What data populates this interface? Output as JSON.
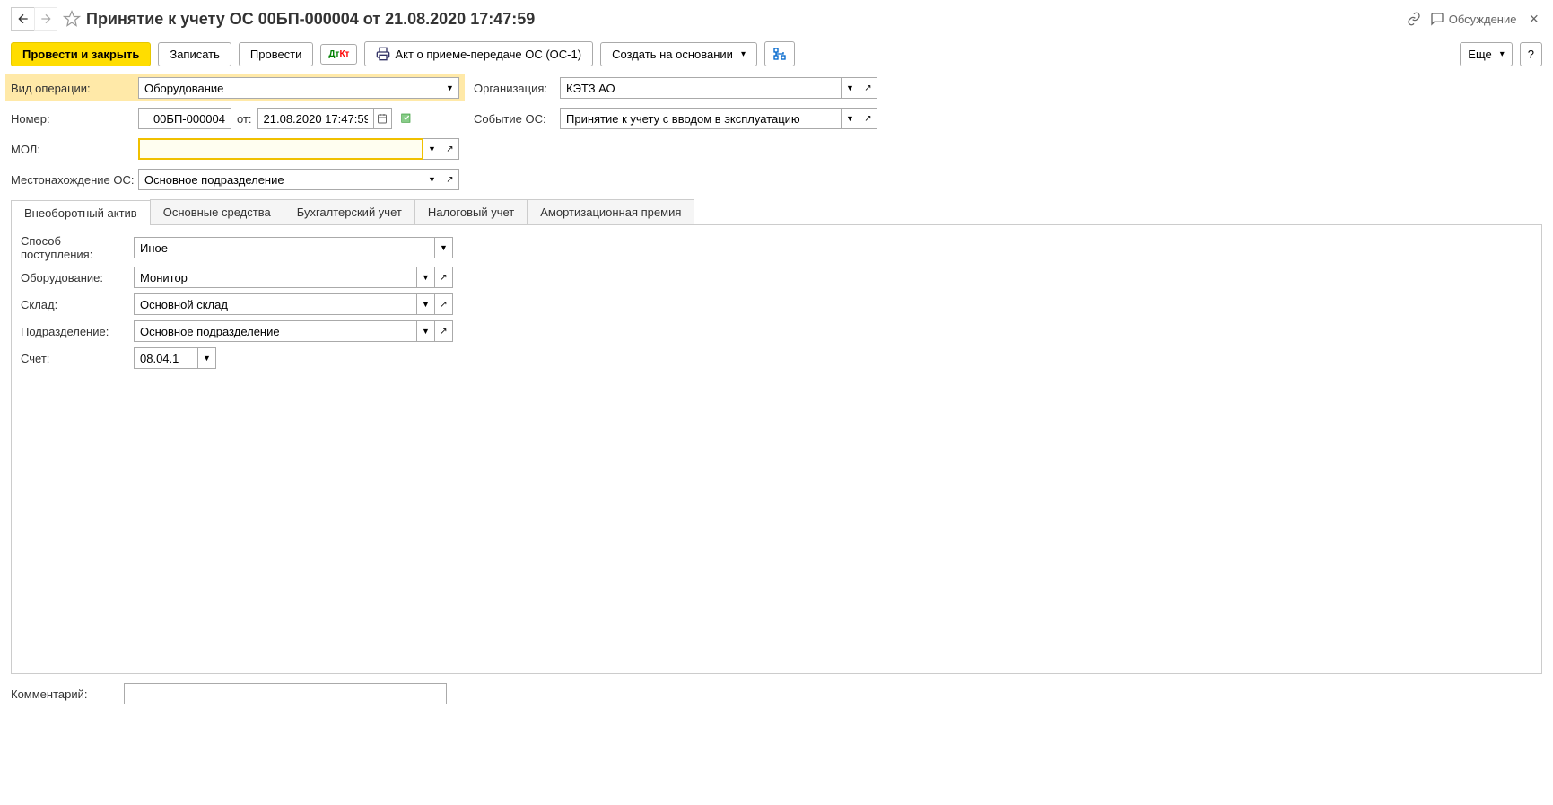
{
  "header": {
    "title": "Принятие к учету ОС 00БП-000004 от 21.08.2020 17:47:59",
    "discussion": "Обсуждение"
  },
  "toolbar": {
    "post_close": "Провести и закрыть",
    "save": "Записать",
    "post": "Провести",
    "act": "Акт о приеме-передаче ОС (ОС-1)",
    "create_based": "Создать на основании",
    "more": "Еще",
    "help": "?"
  },
  "form": {
    "op_type_label": "Вид операции:",
    "op_type_value": "Оборудование",
    "org_label": "Организация:",
    "org_value": "КЭТЗ АО",
    "number_label": "Номер:",
    "number_value": "00БП-000004",
    "from_label": "от:",
    "date_value": "21.08.2020 17:47:59",
    "event_label": "Событие ОС:",
    "event_value": "Принятие к учету с вводом в эксплуатацию",
    "mol_label": "МОЛ:",
    "mol_value": "",
    "location_label": "Местонахождение ОС:",
    "location_value": "Основное подразделение"
  },
  "tabs": [
    "Внеоборотный актив",
    "Основные средства",
    "Бухгалтерский учет",
    "Налоговый учет",
    "Амортизационная премия"
  ],
  "tab1": {
    "receipt_label": "Способ поступления:",
    "receipt_value": "Иное",
    "equip_label": "Оборудование:",
    "equip_value": "Монитор",
    "warehouse_label": "Склад:",
    "warehouse_value": "Основной склад",
    "dept_label": "Подразделение:",
    "dept_value": "Основное подразделение",
    "account_label": "Счет:",
    "account_value": "08.04.1"
  },
  "comment": {
    "label": "Комментарий:",
    "value": ""
  }
}
